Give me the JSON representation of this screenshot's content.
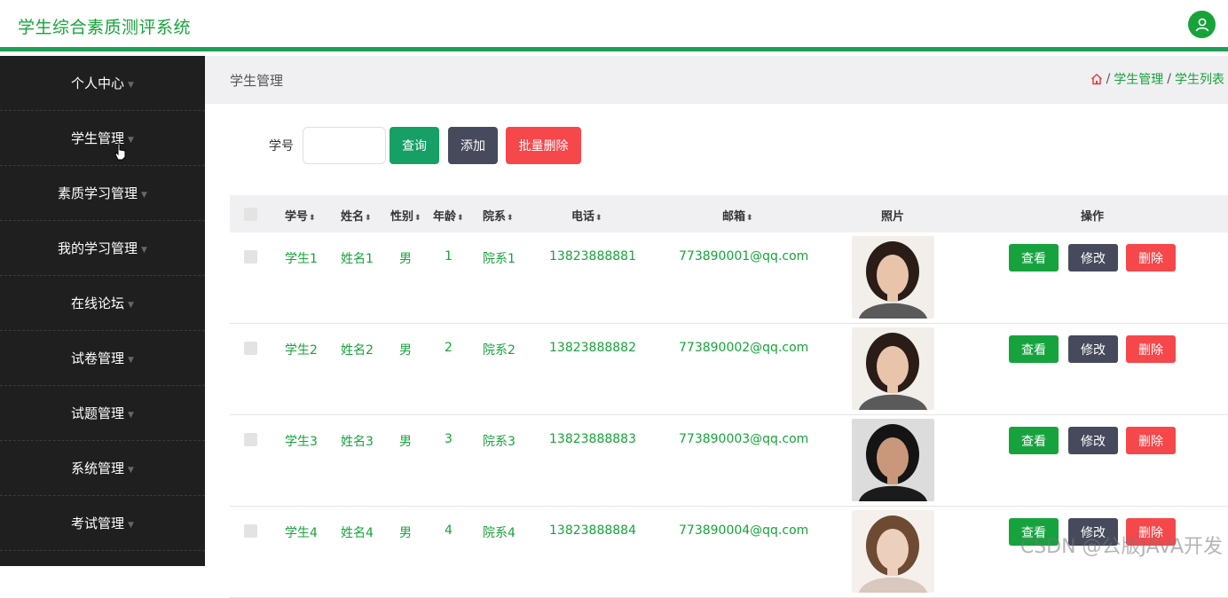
{
  "app": {
    "title": "学生综合素质测评系统"
  },
  "sidebar": {
    "items": [
      {
        "label": "个人中心"
      },
      {
        "label": "学生管理"
      },
      {
        "label": "素质学习管理"
      },
      {
        "label": "我的学习管理"
      },
      {
        "label": "在线论坛"
      },
      {
        "label": "试卷管理"
      },
      {
        "label": "试题管理"
      },
      {
        "label": "系统管理"
      },
      {
        "label": "考试管理"
      }
    ]
  },
  "page": {
    "title": "学生管理",
    "breadcrumb": [
      {
        "label": "学生管理"
      },
      {
        "label": "学生列表"
      }
    ],
    "breadcrumb_sep": "/"
  },
  "search": {
    "label": "学号",
    "value": "",
    "query_button": "查询",
    "add_button": "添加",
    "batch_delete_button": "批量删除"
  },
  "table": {
    "headers": {
      "student_no": "学号",
      "name": "姓名",
      "gender": "性别",
      "age": "年龄",
      "department": "院系",
      "phone": "电话",
      "email": "邮箱",
      "photo": "照片",
      "actions": "操作"
    },
    "actions": {
      "view": "查看",
      "edit": "修改",
      "delete": "删除"
    },
    "rows": [
      {
        "student_no": "学生1",
        "name": "姓名1",
        "gender": "男",
        "age": "1",
        "department": "院系1",
        "phone": "13823888881",
        "email": "773890001@qq.com"
      },
      {
        "student_no": "学生2",
        "name": "姓名2",
        "gender": "男",
        "age": "2",
        "department": "院系2",
        "phone": "13823888882",
        "email": "773890002@qq.com"
      },
      {
        "student_no": "学生3",
        "name": "姓名3",
        "gender": "男",
        "age": "3",
        "department": "院系3",
        "phone": "13823888883",
        "email": "773890003@qq.com"
      },
      {
        "student_no": "学生4",
        "name": "姓名4",
        "gender": "男",
        "age": "4",
        "department": "院系4",
        "phone": "13823888884",
        "email": "773890004@qq.com"
      }
    ]
  },
  "watermark": "CSDN @公版JAVA开发",
  "colors": {
    "accent": "#17a33a",
    "sidebar_bg": "#1f1f1f",
    "danger": "#f6474b",
    "dark": "#474a5c"
  }
}
